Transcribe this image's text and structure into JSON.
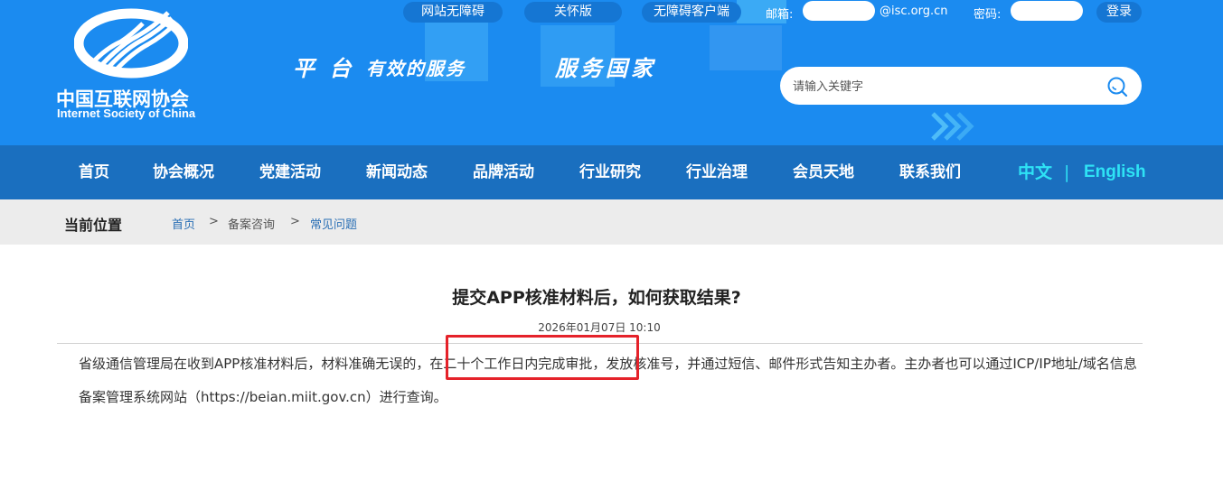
{
  "header": {
    "logo_cn": "中国互联网协会",
    "logo_en": "Internet Society of China",
    "slogan_1": "平 台",
    "slogan_2": "有效的服务",
    "slogan_3": "服务国家",
    "accessibility_label": "网站无障碍",
    "care_mode_label": "关怀版",
    "accessible_client_label": "无障碍客户端",
    "email_label": "邮箱:",
    "email_value": "",
    "email_suffix": "@isc.org.cn",
    "password_label": "密码:",
    "password_value": "",
    "login_label": "登录",
    "search_placeholder": "请输入关键字"
  },
  "nav": {
    "items": [
      "首页",
      "协会概况",
      "党建活动",
      "新闻动态",
      "品牌活动",
      "行业研究",
      "行业治理",
      "会员天地",
      "联系我们"
    ],
    "lang_cn": "中文",
    "lang_sep": "|",
    "lang_en": "English"
  },
  "breadcrumb": {
    "title": "当前位置",
    "items": [
      "首页",
      "备案咨询",
      "常见问题"
    ],
    "sep": ">"
  },
  "article": {
    "title": "提交APP核准材料后，如何获取结果?",
    "date": "2026年01月07日 10:10",
    "body": "省级通信管理局在收到APP核准材料后，材料准确无误的，在二十个工作日内完成审批，发放核准号，并通过短信、邮件形式告知主办者。主办者也可以通过ICP/IP地址/域名信息备案管理系统网站（https://beian.miit.gov.cn）进行查询。"
  },
  "colors": {
    "header_bg": "#1b8bf0",
    "nav_bg": "#1a6fbf",
    "lang_accent": "#2ee3f5",
    "highlight": "#e5222a"
  }
}
